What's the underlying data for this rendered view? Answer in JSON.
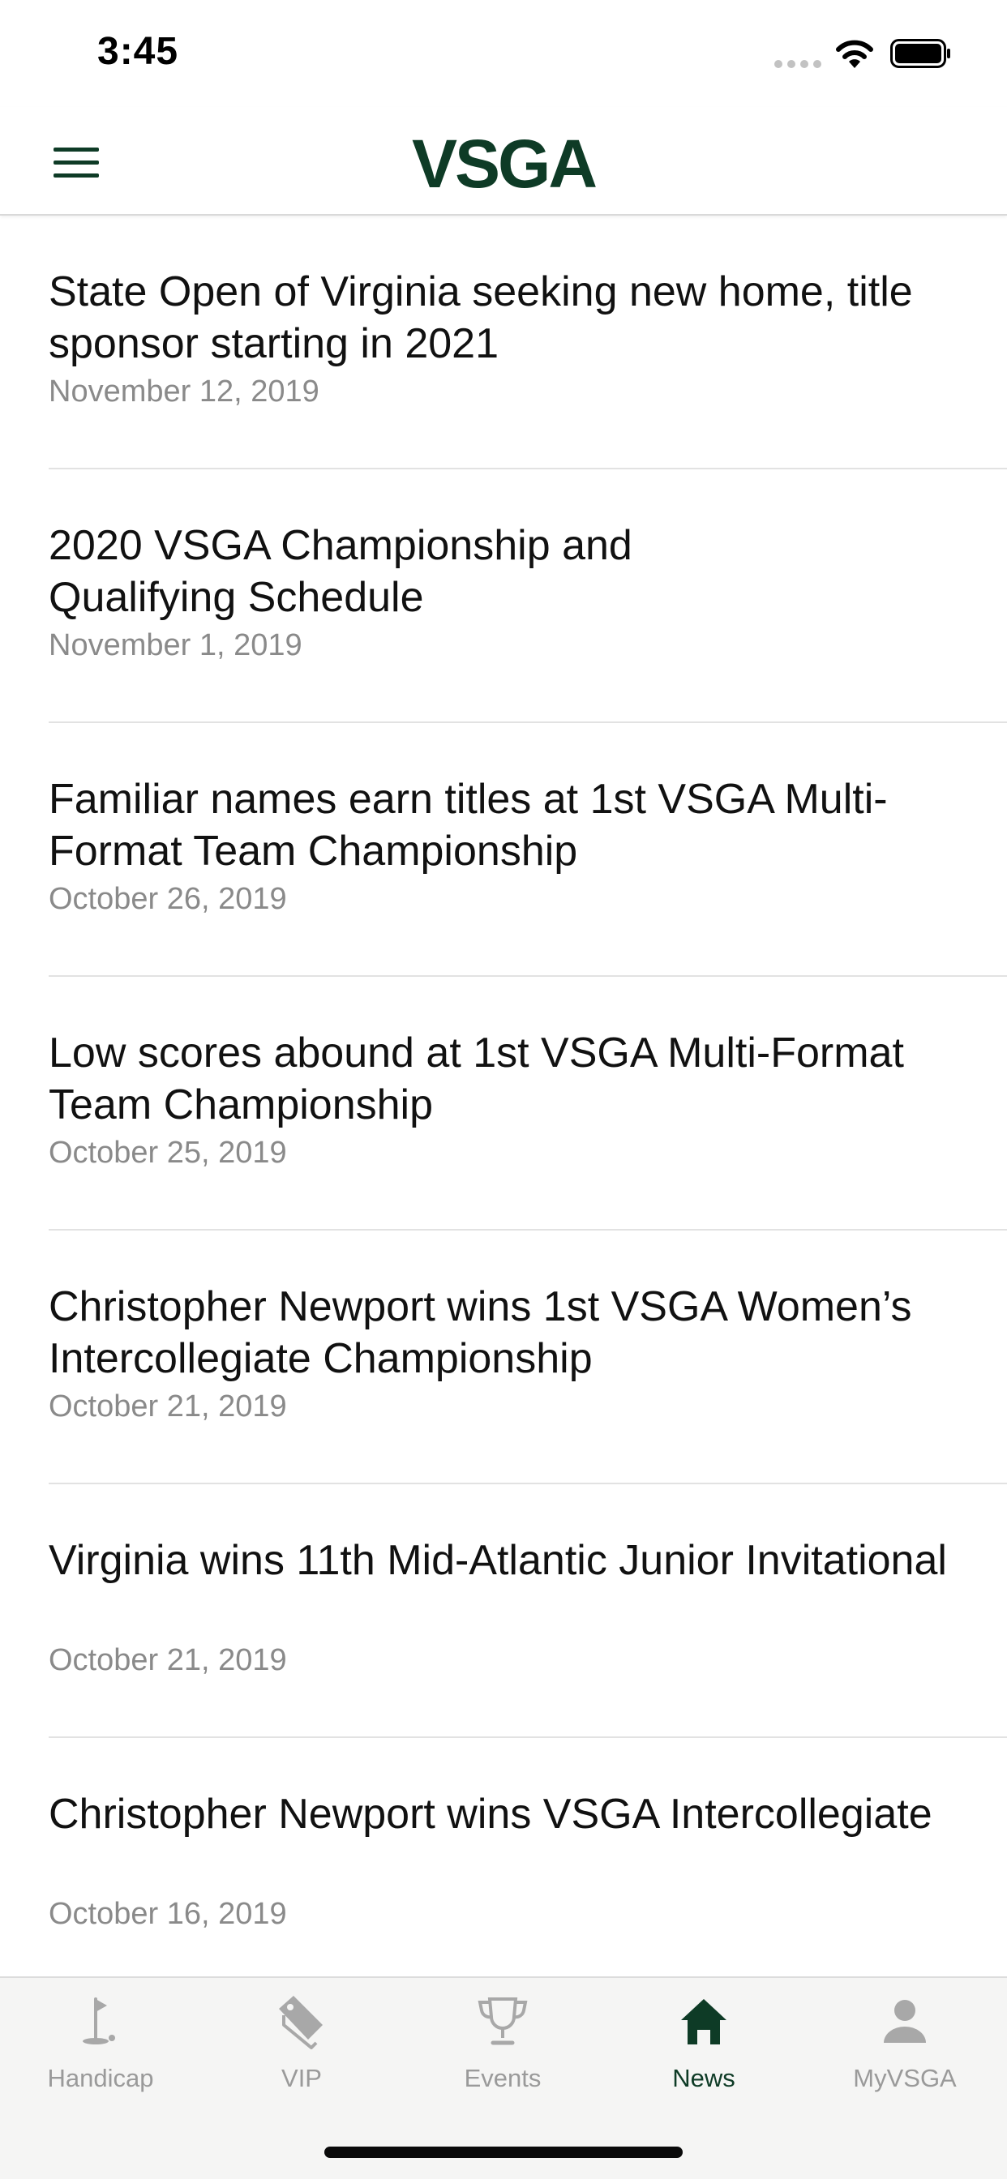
{
  "status_bar": {
    "time": "3:45"
  },
  "nav": {
    "brand": "VSGA",
    "menu_icon": "hamburger-menu-icon",
    "accent_color": "#0e3b26"
  },
  "news": {
    "items": [
      {
        "title": "State Open of Virginia seeking new home, title sponsor starting in 2021",
        "date": "November 12, 2019"
      },
      {
        "title": "2020 VSGA Championship and\nQualifying Schedule",
        "date": "November 1, 2019"
      },
      {
        "title": "Familiar names earn titles at 1st VSGA Multi-Format Team Championship",
        "date": "October 26, 2019"
      },
      {
        "title": "Low scores abound at 1st VSGA Multi-Format Team Championship",
        "date": "October 25, 2019"
      },
      {
        "title": "Christopher Newport wins 1st VSGA Women’s Intercollegiate Championship",
        "date": "October 21, 2019"
      },
      {
        "title": "Virginia wins 11th Mid-Atlantic Junior Invitational",
        "date": "October 21, 2019"
      },
      {
        "title": "Christopher Newport wins VSGA Intercollegiate",
        "date": "October 16, 2019"
      }
    ]
  },
  "tab_bar": {
    "tabs": [
      {
        "label": "Handicap",
        "icon": "golf-flag-icon",
        "active": false
      },
      {
        "label": "VIP",
        "icon": "tag-icon",
        "active": false
      },
      {
        "label": "Events",
        "icon": "trophy-icon",
        "active": false
      },
      {
        "label": "News",
        "icon": "home-icon",
        "active": true
      },
      {
        "label": "MyVSGA",
        "icon": "person-icon",
        "active": false
      }
    ],
    "active_color": "#0e3b26",
    "inactive_color": "#9a9a9a"
  }
}
